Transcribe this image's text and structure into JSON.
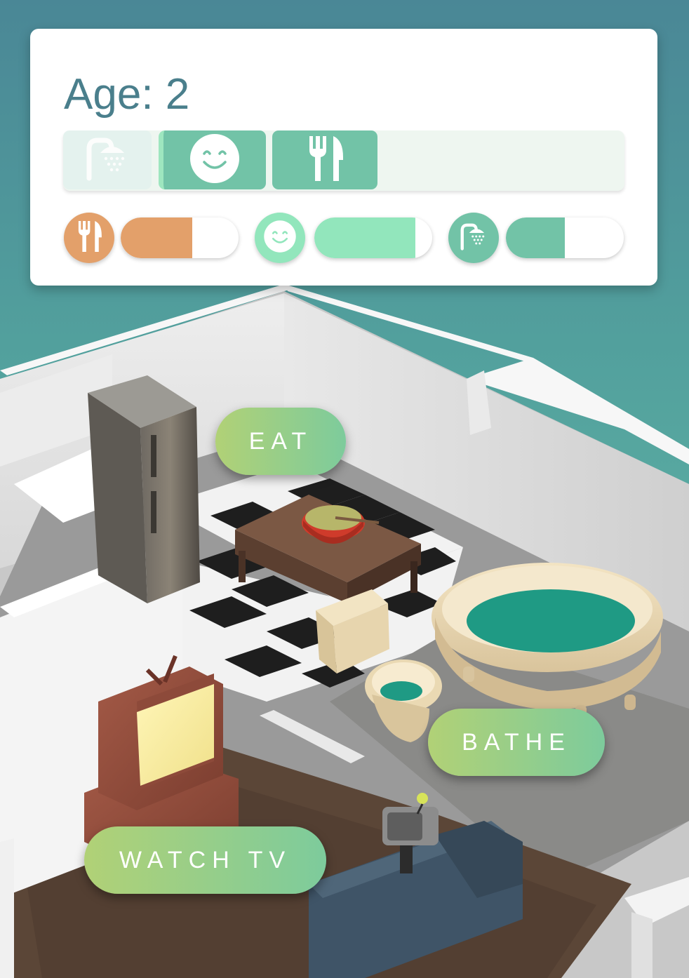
{
  "hud": {
    "age_label": "Age: 2",
    "action_queue": [
      {
        "icon": "shower-icon",
        "state": "completed"
      },
      {
        "icon": "smiley-icon",
        "state": "active"
      },
      {
        "icon": "fork-knife-icon",
        "state": "queued"
      }
    ],
    "needs": [
      {
        "name": "hunger",
        "icon": "fork-knife-icon",
        "level_pct": 61,
        "color": "#e3a06a"
      },
      {
        "name": "fun",
        "icon": "smiley-icon",
        "level_pct": 86,
        "color": "#92e6bc"
      },
      {
        "name": "hygiene",
        "icon": "shower-icon",
        "level_pct": 50,
        "color": "#72c3a7"
      }
    ]
  },
  "actions": {
    "eat_label": "EAT",
    "bathe_label": "BATHE",
    "watch_tv_label": "WATCH TV"
  },
  "colors": {
    "accent_teal": "#72c3a7",
    "hunger_orange": "#e3a06a",
    "fun_mint": "#92e6bc",
    "button_gradient_start": "#b1d176",
    "button_gradient_end": "#7dcb9c",
    "age_text": "#4a7f8c"
  }
}
